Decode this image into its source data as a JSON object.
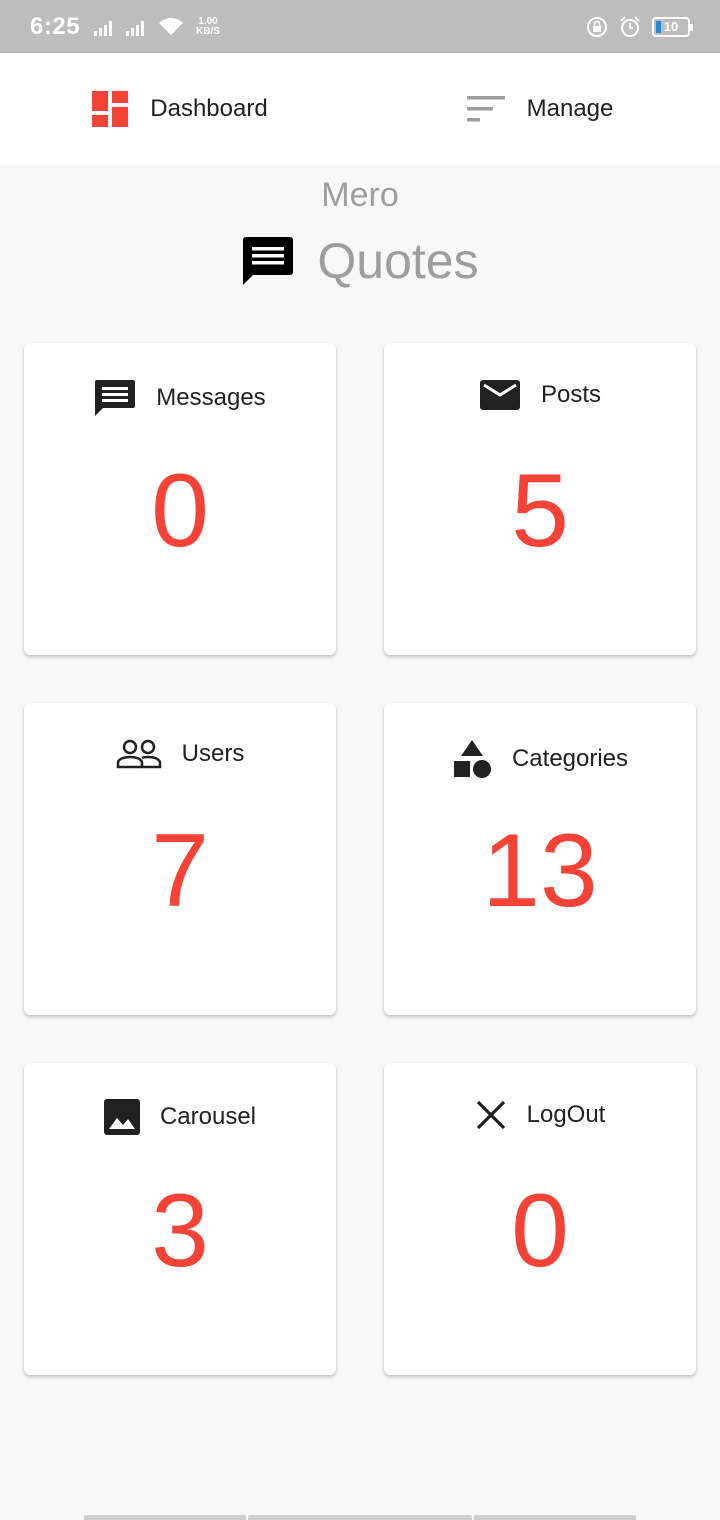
{
  "status_bar": {
    "time": "6:25",
    "net_speed_value": "1.00",
    "net_speed_unit": "KB/S",
    "battery_level": "10"
  },
  "nav": {
    "dashboard_label": "Dashboard",
    "manage_label": "Manage",
    "active": "Dashboard",
    "dashboard_icon": "dashboard-icon",
    "manage_icon": "sort-icon"
  },
  "header": {
    "subtitle": "Mero",
    "title": "Quotes",
    "title_icon": "chat-icon"
  },
  "cards": [
    {
      "label": "Messages",
      "value": "0",
      "icon": "message-icon"
    },
    {
      "label": "Posts",
      "value": "5",
      "icon": "mail-icon"
    },
    {
      "label": "Users",
      "value": "7",
      "icon": "people-icon"
    },
    {
      "label": "Categories",
      "value": "13",
      "icon": "category-icon"
    },
    {
      "label": "Carousel",
      "value": "3",
      "icon": "image-icon"
    },
    {
      "label": "LogOut",
      "value": "0",
      "icon": "close-icon"
    }
  ],
  "colors": {
    "accent": "#f44336",
    "status_bar": "#bdbdbd",
    "background": "#f8f8f8",
    "muted_text": "#9e9e9e"
  }
}
